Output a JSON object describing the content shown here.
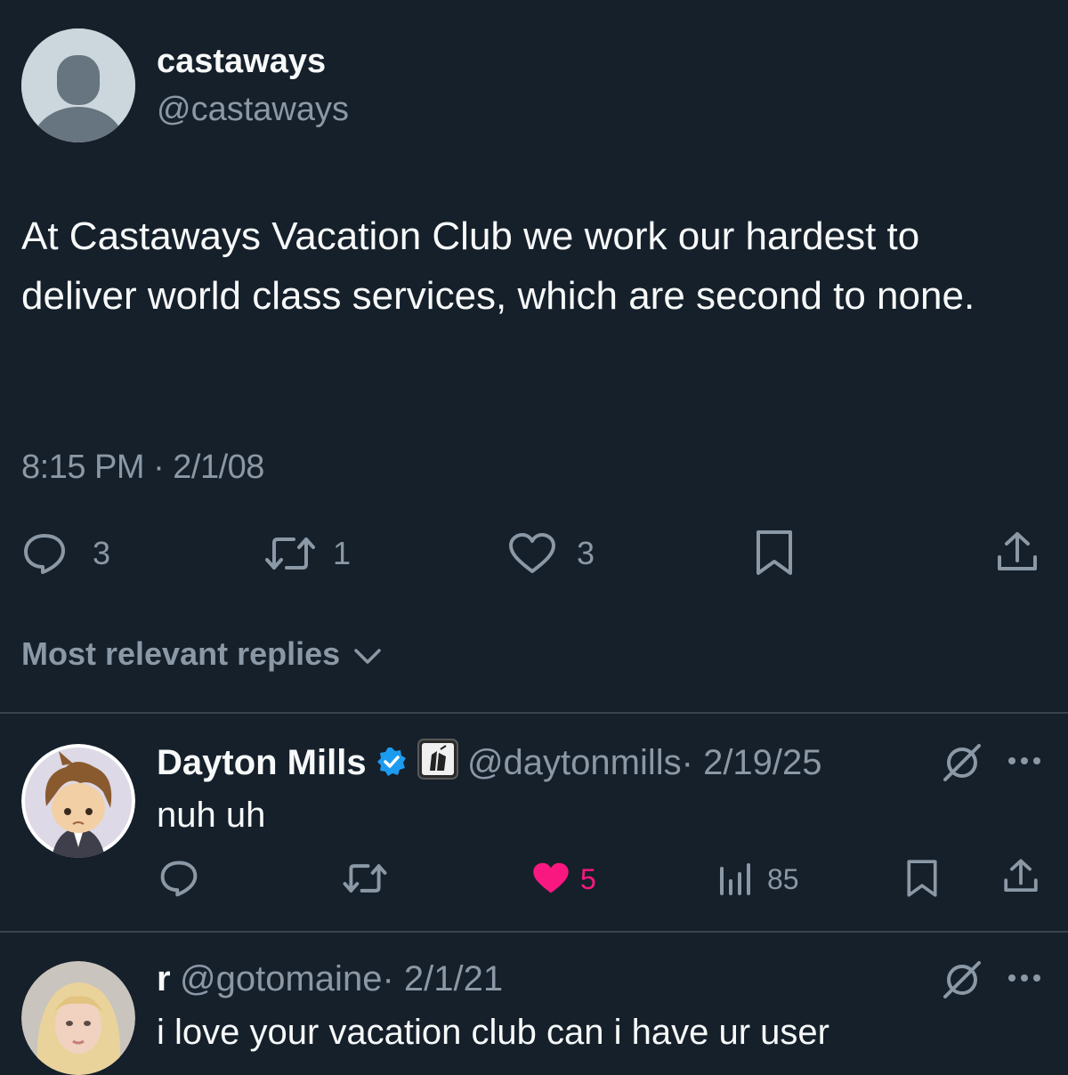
{
  "tweet": {
    "display_name": "castaways",
    "handle": "@castaways",
    "text": "At Castaways Vacation Club we work our hardest to deliver world class services, which are second to none.",
    "timestamp": "8:15 PM · 2/1/08",
    "replies": "3",
    "retweets": "1",
    "likes": "3"
  },
  "sort": {
    "label": "Most relevant replies"
  },
  "replies": [
    {
      "display_name": "Dayton Mills",
      "handle": "@daytonmills",
      "date": "· 2/19/25",
      "text": "nuh uh",
      "likes": "5",
      "views": "85"
    },
    {
      "display_name": "r",
      "handle": "@gotomaine",
      "date": "· 2/1/21",
      "text": "i love your vacation club can i have ur user"
    }
  ],
  "colors": {
    "background": "#15202b",
    "muted": "#8b98a5",
    "like_active": "#f91880",
    "verified": "#1d9bf0"
  }
}
